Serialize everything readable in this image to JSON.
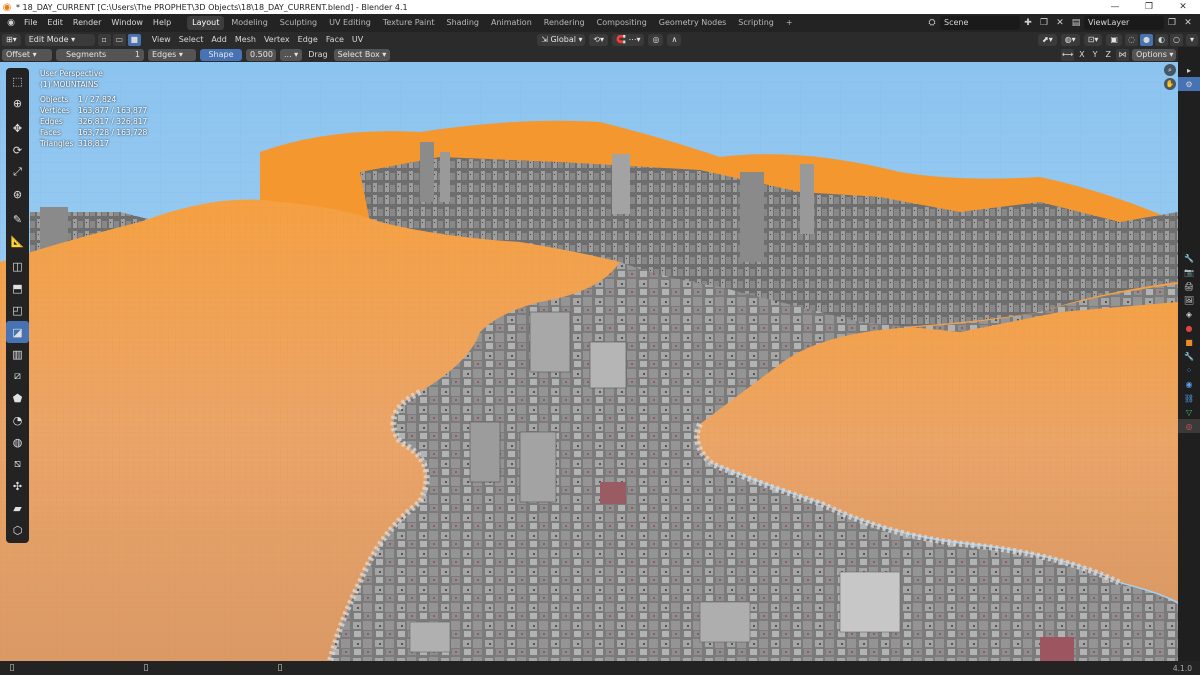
{
  "window": {
    "title": "* 18_DAY_CURRENT [C:\\Users\\The PROPHET\\3D Objects\\18\\18_DAY_CURRENT.blend] - Blender 4.1",
    "controls": [
      "—",
      "❐",
      "✕"
    ]
  },
  "menubar": {
    "menus": [
      "File",
      "Edit",
      "Render",
      "Window",
      "Help"
    ],
    "workspaces": [
      "Layout",
      "Modeling",
      "Sculpting",
      "UV Editing",
      "Texture Paint",
      "Shading",
      "Animation",
      "Rendering",
      "Compositing",
      "Geometry Nodes",
      "Scripting"
    ],
    "active_workspace": "Layout",
    "add_tab": "+",
    "scene": "Scene",
    "view_layer": "ViewLayer"
  },
  "header": {
    "mode": "Edit Mode",
    "menus": [
      "View",
      "Select",
      "Add",
      "Mesh",
      "Vertex",
      "Edge",
      "Face",
      "UV"
    ],
    "transform_orientation": "Global",
    "axes": [
      "X",
      "Y",
      "Z"
    ],
    "options": "Options"
  },
  "operator": {
    "offset": "Offset",
    "segments_label": "Segments",
    "segments_value": "1",
    "affect": "Edges",
    "shape_label": "Shape",
    "shape_value": "0.500",
    "more": "...",
    "drag_label": "Drag",
    "select_box": "Select Box"
  },
  "viewport": {
    "view_name": "User Perspective",
    "object_name": "(1) MOUNTAINS",
    "stats": [
      {
        "key": "Objects",
        "value": "1 / 27,824"
      },
      {
        "key": "Vertices",
        "value": "163,877 / 163,877"
      },
      {
        "key": "Edges",
        "value": "326,817 / 326,817"
      },
      {
        "key": "Faces",
        "value": "163,728 / 163,728"
      },
      {
        "key": "Triangles",
        "value": "318,817"
      }
    ]
  },
  "status": {
    "version": "4.1.0"
  },
  "colors": {
    "accent": "#4772b3",
    "sky": "#8fc4ef",
    "terrain": "#f3963a",
    "buildings": "#8d8d8d"
  }
}
